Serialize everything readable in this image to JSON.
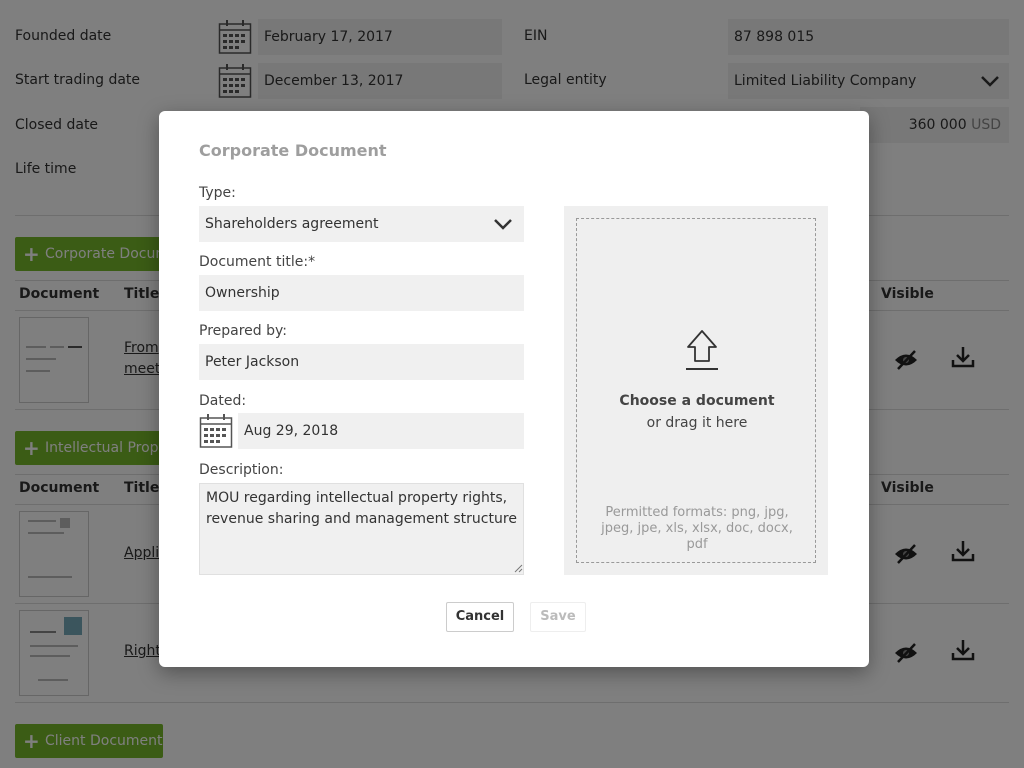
{
  "page": {
    "founded_label": "Founded date",
    "founded_value": "February 17, 2017",
    "start_trading_label": "Start trading date",
    "start_trading_value": "December 13, 2017",
    "closed_label": "Closed date",
    "life_time_label": "Life time",
    "ein_label": "EIN",
    "ein_value": "87 898 015",
    "legal_entity_label": "Legal entity",
    "legal_entity_value": "Limited Liability Company",
    "amount_value": "360 000",
    "amount_currency": "USD",
    "sections": [
      {
        "button_label": "Corporate Docum"
      },
      {
        "button_label": "Intellectual Prope"
      },
      {
        "button_label": "Client Document"
      }
    ],
    "columns": {
      "document": "Document",
      "title": "Title",
      "visible": "Visible"
    },
    "rows": [
      {
        "title_line1": "From",
        "title_line2": "meet"
      },
      {
        "title_line1": "Appli"
      },
      {
        "title_line1": "Right"
      }
    ]
  },
  "modal": {
    "title": "Corporate Document",
    "type_label": "Type:",
    "type_value": "Shareholders agreement",
    "doc_title_label": "Document title:*",
    "doc_title_value": "Ownership",
    "prepared_by_label": "Prepared by:",
    "prepared_by_value": "Peter Jackson",
    "dated_label": "Dated:",
    "dated_value": "Aug 29, 2018",
    "description_label": "Description:",
    "description_value": "MOU regarding intellectual property rights, revenue sharing and management structure",
    "drop_main": "Choose a document",
    "drop_sub": "or drag it here",
    "drop_note": "Permitted formats: png, jpg, jpeg, jpe, xls, xlsx, doc, docx, pdf",
    "cancel_label": "Cancel",
    "save_label": "Save"
  },
  "colors": {
    "accent_green": "#76b82a",
    "field_bg": "#f0f0f0",
    "overlay": "#000000"
  },
  "icons": [
    "calendar-icon",
    "chevron-down-icon",
    "eye-off-icon",
    "download-icon",
    "upload-icon",
    "plus-icon"
  ]
}
